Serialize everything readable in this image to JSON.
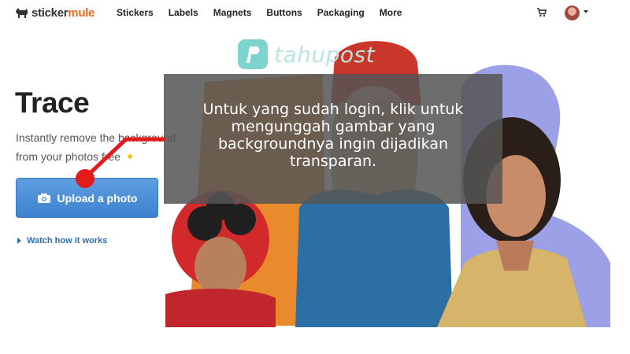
{
  "brand": {
    "part1": "sticker",
    "part2": "mule"
  },
  "nav": [
    "Stickers",
    "Labels",
    "Magnets",
    "Buttons",
    "Packaging",
    "More"
  ],
  "icons": {
    "cart": "cart-icon",
    "avatar": "user-avatar",
    "caret": "caret-down-icon",
    "camera": "camera-icon",
    "sparkle": "sparkle-icon",
    "play": "play-triangle-icon"
  },
  "hero": {
    "title": "Trace",
    "subtitle": "Instantly remove the background from your photos free",
    "upload_label": "Upload a photo",
    "watch_label": "Watch how it works"
  },
  "overlay": {
    "lines": [
      "Untuk yang sudah login, klik untuk",
      "mengunggah gambar yang",
      "backgroundnya ingin dijadikan",
      "transparan."
    ]
  },
  "watermark": {
    "text": "tahupost"
  },
  "colors": {
    "accent_blue": "#4a8fd8",
    "brand_orange": "#f26b21",
    "annotation_red": "#e31b1b"
  }
}
